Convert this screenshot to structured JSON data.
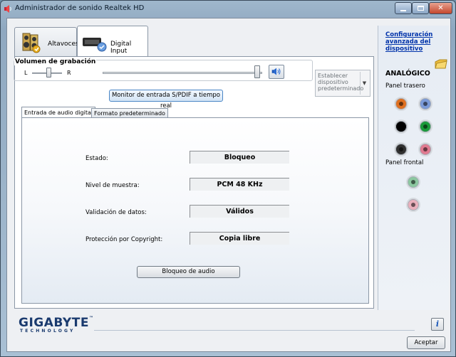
{
  "window": {
    "title": "Administrador de sonido Realtek HD",
    "min_icon": "minimize-icon",
    "max_icon": "maximize-icon",
    "close_icon": "close-icon"
  },
  "device_tabs": [
    {
      "label": "Altavoces",
      "icon": "speaker-icon",
      "active": false
    },
    {
      "label": "Digital Input",
      "icon": "digital-input-icon",
      "active": true
    }
  ],
  "volume": {
    "label": "Volumen de grabación",
    "left_label": "L",
    "right_label": "R",
    "balance": 0.5,
    "level": 1.0,
    "mute_icon": "speaker-volume-icon"
  },
  "default_device": {
    "text": "Establecer dispositivo predeterminado",
    "enabled": false
  },
  "monitor_button": "Monitor de entrada S/PDIF a tiempo real",
  "sub_tabs": [
    {
      "label": "Entrada de audio digital",
      "active": true
    },
    {
      "label": "Formato predeterminado",
      "active": false
    }
  ],
  "rows": [
    {
      "label": "Estado:",
      "value": "Bloqueo"
    },
    {
      "label": "Nivel de muestra:",
      "value": "PCM 48 KHz"
    },
    {
      "label": "Validación de datos:",
      "value": "Válidos"
    },
    {
      "label": "Protección por Copyright:",
      "value": "Copia libre"
    }
  ],
  "lock_button": "Bloqueo de audio",
  "side": {
    "advanced_link": "Configuración avanzada del dispositivo",
    "analog_title": "ANALÓGICO",
    "rear_label": "Panel trasero",
    "front_label": "Panel frontal",
    "rear_jacks": [
      {
        "color": "#e07020",
        "name": "orange-jack"
      },
      {
        "color": "#7a9ad8",
        "name": "blue-jack"
      },
      {
        "color": "#000000",
        "name": "black-jack"
      },
      {
        "color": "#1a9a3a",
        "name": "green-jack"
      },
      {
        "color": "#303030",
        "name": "gray-jack"
      },
      {
        "color": "#e07a90",
        "name": "pink-jack"
      }
    ],
    "front_jacks": [
      {
        "color": "#8cc8a0",
        "name": "front-green-jack"
      },
      {
        "color": "#eab0bc",
        "name": "front-pink-jack"
      }
    ]
  },
  "footer": {
    "logo": "GIGABYTE",
    "logo_tm": "™",
    "logo_sub": "TECHNOLOGY",
    "info_label": "i",
    "ok_button": "Aceptar"
  }
}
